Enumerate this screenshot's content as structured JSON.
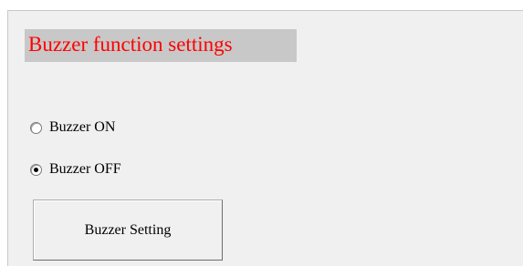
{
  "section": {
    "title": "Buzzer function settings",
    "title_color": "#ff0000",
    "title_bg": "#c8c8c8"
  },
  "options": [
    {
      "label": "Buzzer ON",
      "selected": false
    },
    {
      "label": "Buzzer OFF",
      "selected": true
    }
  ],
  "button": {
    "label": "Buzzer Setting"
  }
}
